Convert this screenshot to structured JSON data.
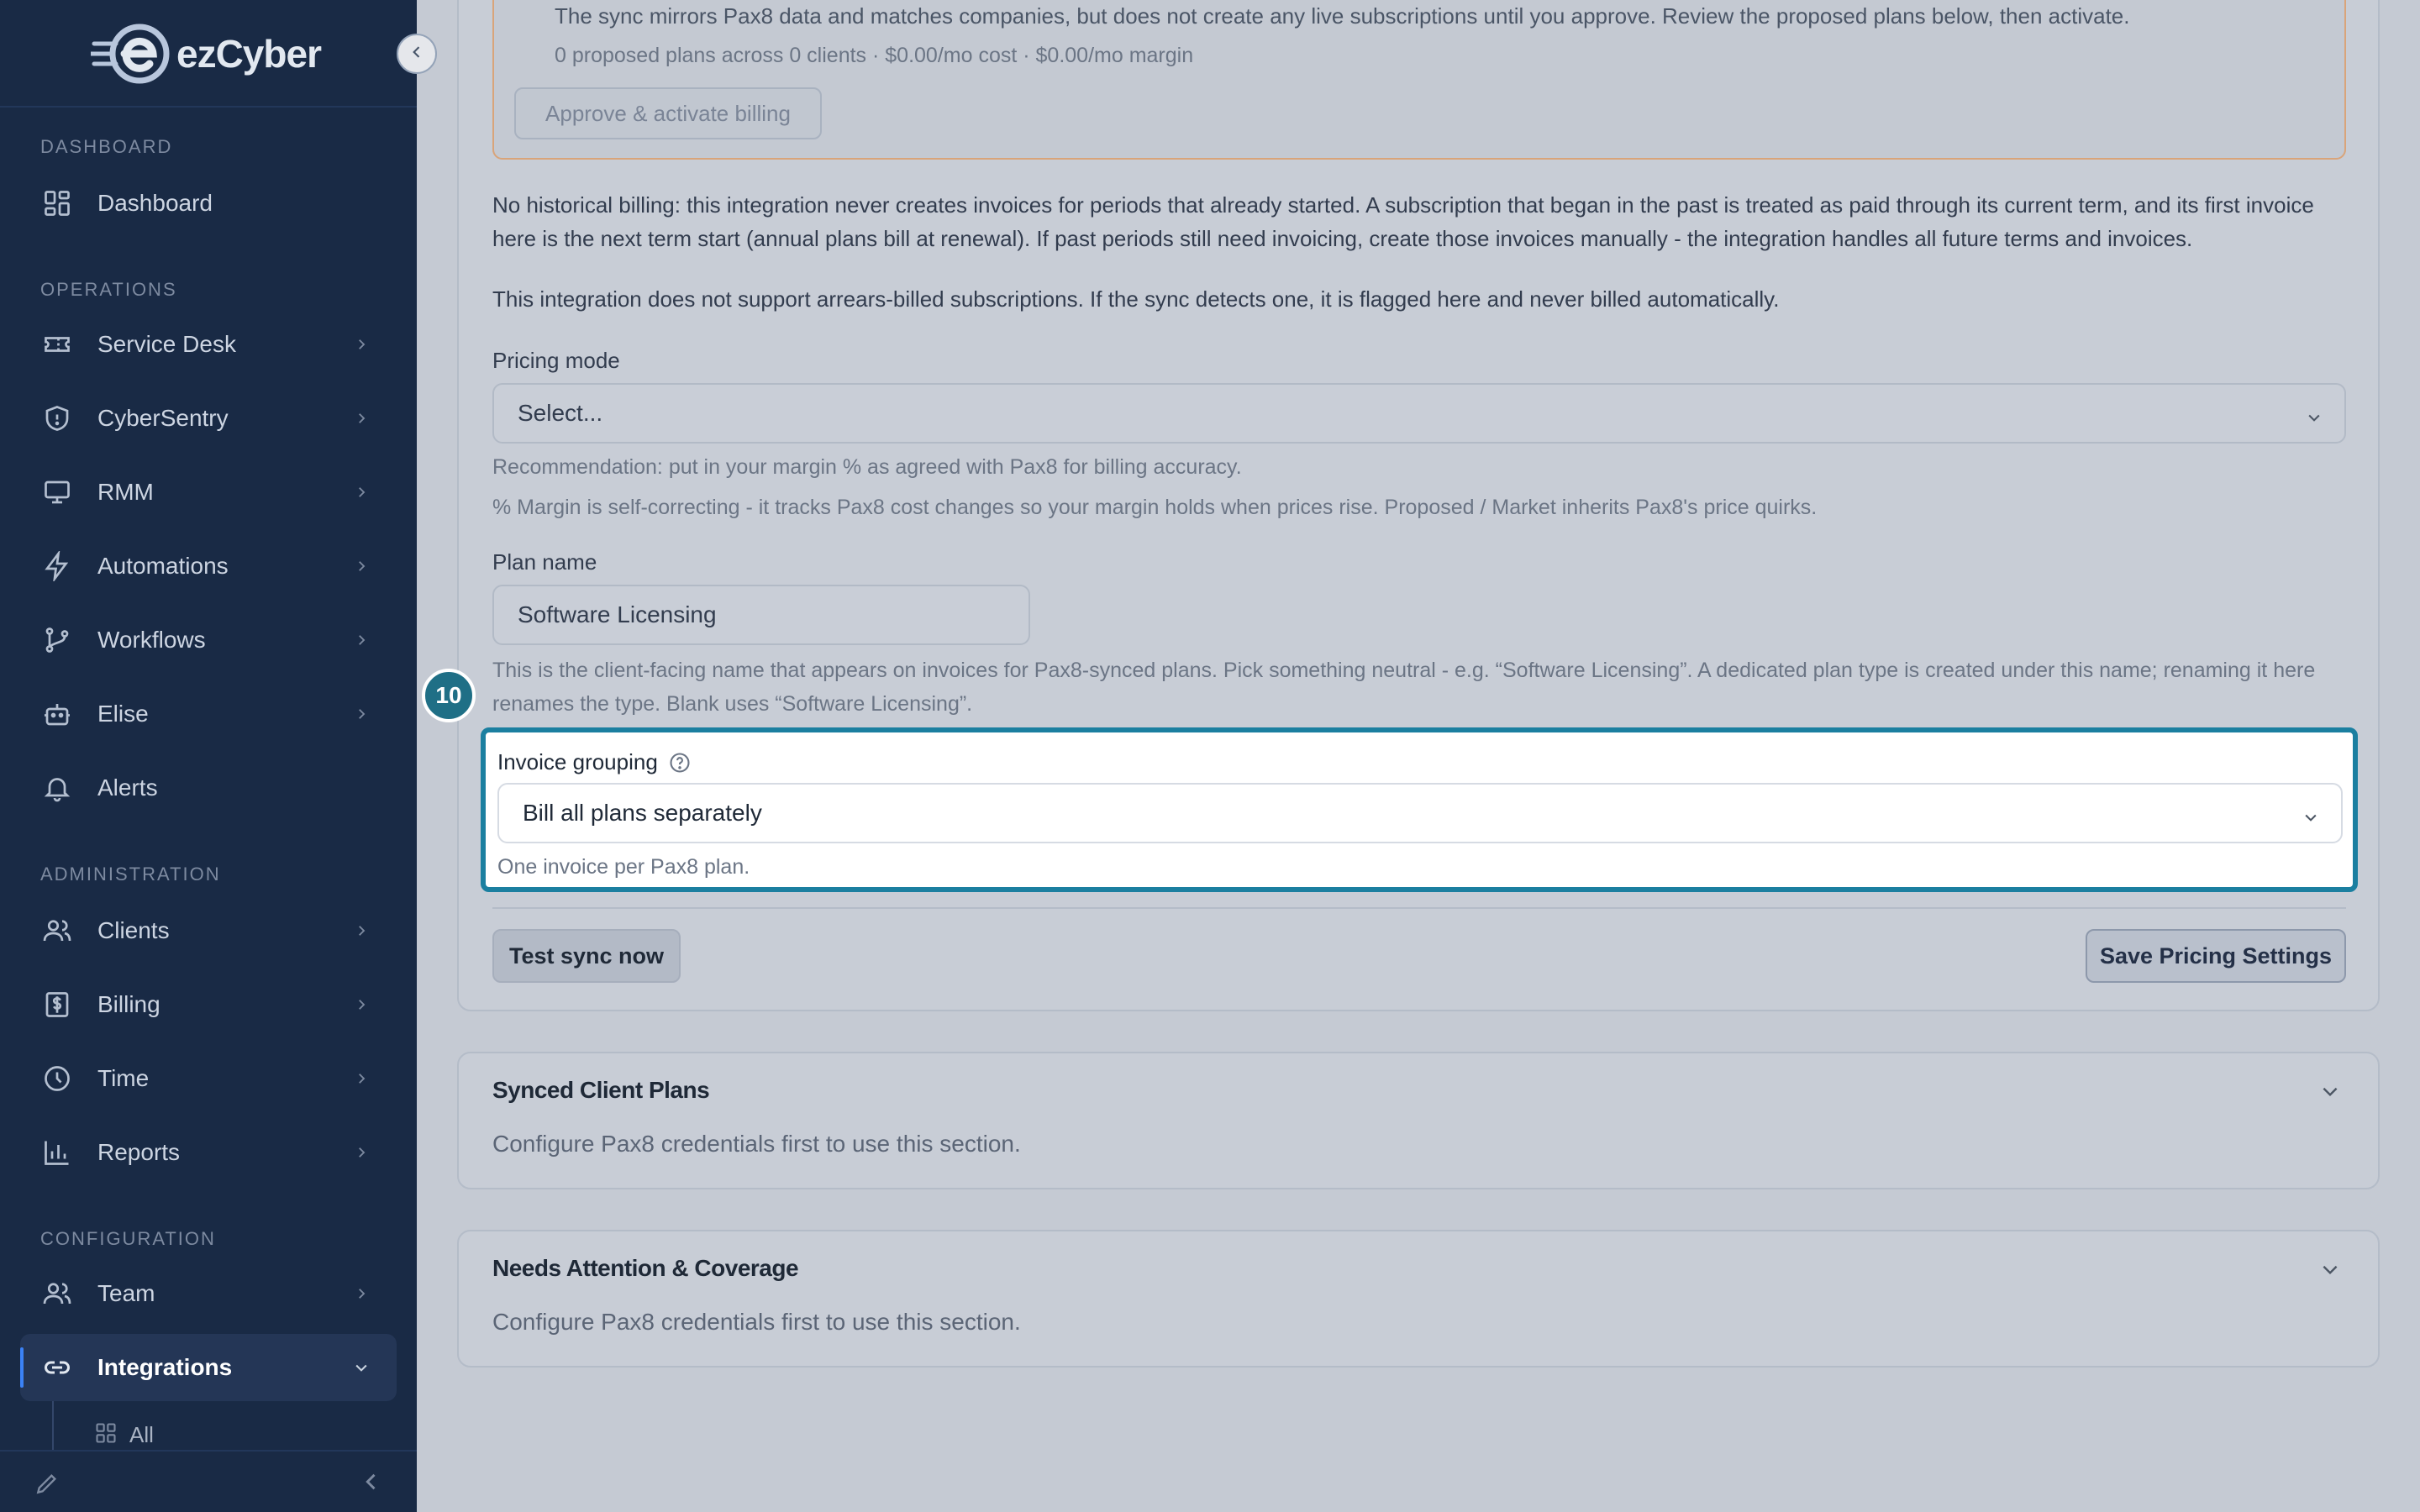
{
  "brand": {
    "logo_text": "ezCyber"
  },
  "sidebar": {
    "sections": {
      "dashboard": "DASHBOARD",
      "operations": "OPERATIONS",
      "administration": "ADMINISTRATION",
      "configuration": "CONFIGURATION"
    },
    "items": {
      "dashboard": "Dashboard",
      "service_desk": "Service Desk",
      "cybersentry": "CyberSentry",
      "rmm": "RMM",
      "automations": "Automations",
      "workflows": "Workflows",
      "elise": "Elise",
      "alerts": "Alerts",
      "clients": "Clients",
      "billing": "Billing",
      "time": "Time",
      "reports": "Reports",
      "team": "Team",
      "integrations": "Integrations",
      "all": "All"
    }
  },
  "approval": {
    "text": "The sync mirrors Pax8 data and matches companies, but does not create any live subscriptions until you approve. Review the proposed plans below, then activate.",
    "summary": "0 proposed plans across 0 clients · $0.00/mo cost · $0.00/mo margin",
    "button": "Approve & activate billing"
  },
  "notes": {
    "historical": "No historical billing: this integration never creates invoices for periods that already started. A subscription that began in the past is treated as paid through its current term, and its first invoice here is the next term start (annual plans bill at renewal). If past periods still need invoicing, create those invoices manually - the integration handles all future terms and invoices.",
    "arrears": "This integration does not support arrears-billed subscriptions. If the sync detects one, it is flagged here and never billed automatically."
  },
  "pricing_mode": {
    "label": "Pricing mode",
    "value": "Select...",
    "help1": "Recommendation: put in your margin % as agreed with Pax8 for billing accuracy.",
    "help2": "% Margin is self-correcting - it tracks Pax8 cost changes so your margin holds when prices rise. Proposed / Market inherits Pax8's price quirks."
  },
  "plan_name": {
    "label": "Plan name",
    "value": "Software Licensing",
    "help": "This is the client-facing name that appears on invoices for Pax8-synced plans. Pick something neutral - e.g. “Software Licensing”. A dedicated plan type is created under this name; renaming it here renames the type. Blank uses “Software Licensing”."
  },
  "step_badge": "10",
  "invoice_grouping": {
    "label": "Invoice grouping",
    "value": "Bill all plans separately",
    "help": "One invoice per Pax8 plan."
  },
  "actions": {
    "test_sync": "Test sync now",
    "save": "Save Pricing Settings"
  },
  "synced_plans": {
    "title": "Synced Client Plans",
    "body": "Configure Pax8 credentials first to use this section."
  },
  "needs_attention": {
    "title": "Needs Attention & Coverage",
    "body": "Configure Pax8 credentials first to use this section."
  }
}
